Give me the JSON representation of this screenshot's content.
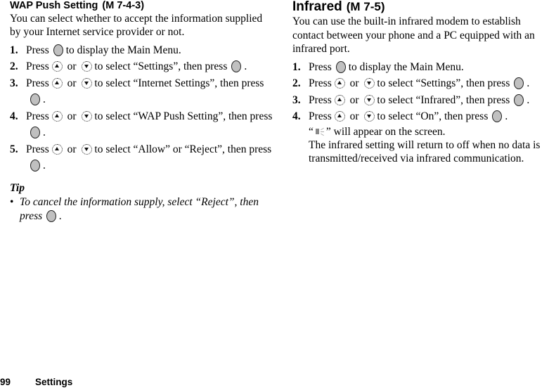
{
  "left_section": {
    "title": "WAP Push Setting",
    "menu_ref": "(M 7-4-3)",
    "intro": "You can select whether to accept the information supplied by your Internet service provider or not.",
    "steps": [
      {
        "num": "1.",
        "a": "Press",
        "b": "to display the Main Menu."
      },
      {
        "num": "2.",
        "a": "Press",
        "or": "or",
        "b": "to select “Settings”, then press",
        "end": "."
      },
      {
        "num": "3.",
        "a": "Press",
        "or": "or",
        "b": "to select “Internet Settings”, then press",
        "end": "."
      },
      {
        "num": "4.",
        "a": "Press",
        "or": "or",
        "b": "to select “WAP Push Setting”, then press",
        "end": "."
      },
      {
        "num": "5.",
        "a": "Press",
        "or": "or",
        "b": "to select “Allow” or “Reject”, then press",
        "end": "."
      }
    ],
    "tip": {
      "title": "Tip",
      "bullet": "•",
      "text": "To cancel the information supply, select “Reject”, then press",
      "end": "."
    }
  },
  "right_section": {
    "title": "Infrared",
    "menu_ref": "(M 7-5)",
    "intro": "You can use the built-in infrared modem to establish contact between your phone and a PC equipped with an infrared port.",
    "steps": [
      {
        "num": "1.",
        "a": "Press",
        "b": "to display the Main Menu."
      },
      {
        "num": "2.",
        "a": "Press",
        "or": "or",
        "b": "to select “Settings”, then press",
        "end": "."
      },
      {
        "num": "3.",
        "a": "Press",
        "or": "or",
        "b": "to select “Infrared”, then press",
        "end": "."
      },
      {
        "num": "4.",
        "a": "Press",
        "or": "or",
        "b": "to select “On”, then press",
        "end": "."
      }
    ],
    "note_open": "“",
    "note_close": "” will appear on the screen.",
    "note2": "The infrared setting will return to off when no data is transmitted/received via infrared communication."
  },
  "footer": {
    "page_number": "99",
    "section": "Settings"
  },
  "icons": {
    "center_key": "center-select-key",
    "up_key": "up-arrow-key",
    "down_key": "down-arrow-key",
    "infrared": "infrared-indicator"
  }
}
